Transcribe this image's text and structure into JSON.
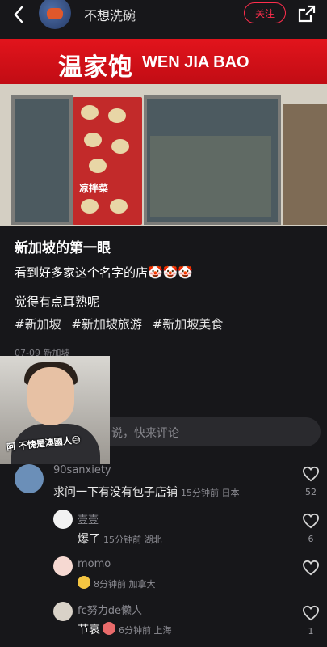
{
  "header": {
    "username": "不想洗碗",
    "follow_label": "关注"
  },
  "photo": {
    "sign_cn": "温家饱",
    "sign_en": "WEN JIA BAO",
    "poster_label": "凉拌菜"
  },
  "post": {
    "title": "新加坡的第一眼",
    "line1": "看到好多家这个名字的店🤡🤡🤡",
    "line2": "觉得有点耳熟呢",
    "tags": [
      "#新加坡",
      "#新加坡旅游",
      "#新加坡美食"
    ],
    "meta": "07-09 新加坡"
  },
  "video_overlay": {
    "caption": "阿 不愧是澳國人😅"
  },
  "comment_box": {
    "placeholder": "说，快来评论"
  },
  "comments": [
    {
      "name": "90sanxiety",
      "text": "求问一下有没有包子店铺",
      "time": "15分钟前 日本",
      "likes": "52"
    },
    {
      "name": "壹壹",
      "text": "爆了",
      "time": "15分钟前 湖北",
      "likes": "6"
    },
    {
      "name": "momo",
      "text": "",
      "time": "8分钟前 加拿大",
      "likes": ""
    },
    {
      "name": "fc努力de懒人",
      "text": "节哀",
      "time": "6分钟前 上海",
      "likes": "1"
    }
  ],
  "colors": {
    "accent": "#ff2e4d",
    "background": "#17171a",
    "sign_red": "#e2141c"
  },
  "icons": [
    "back-chevron-icon",
    "share-icon",
    "heart-icon"
  ]
}
